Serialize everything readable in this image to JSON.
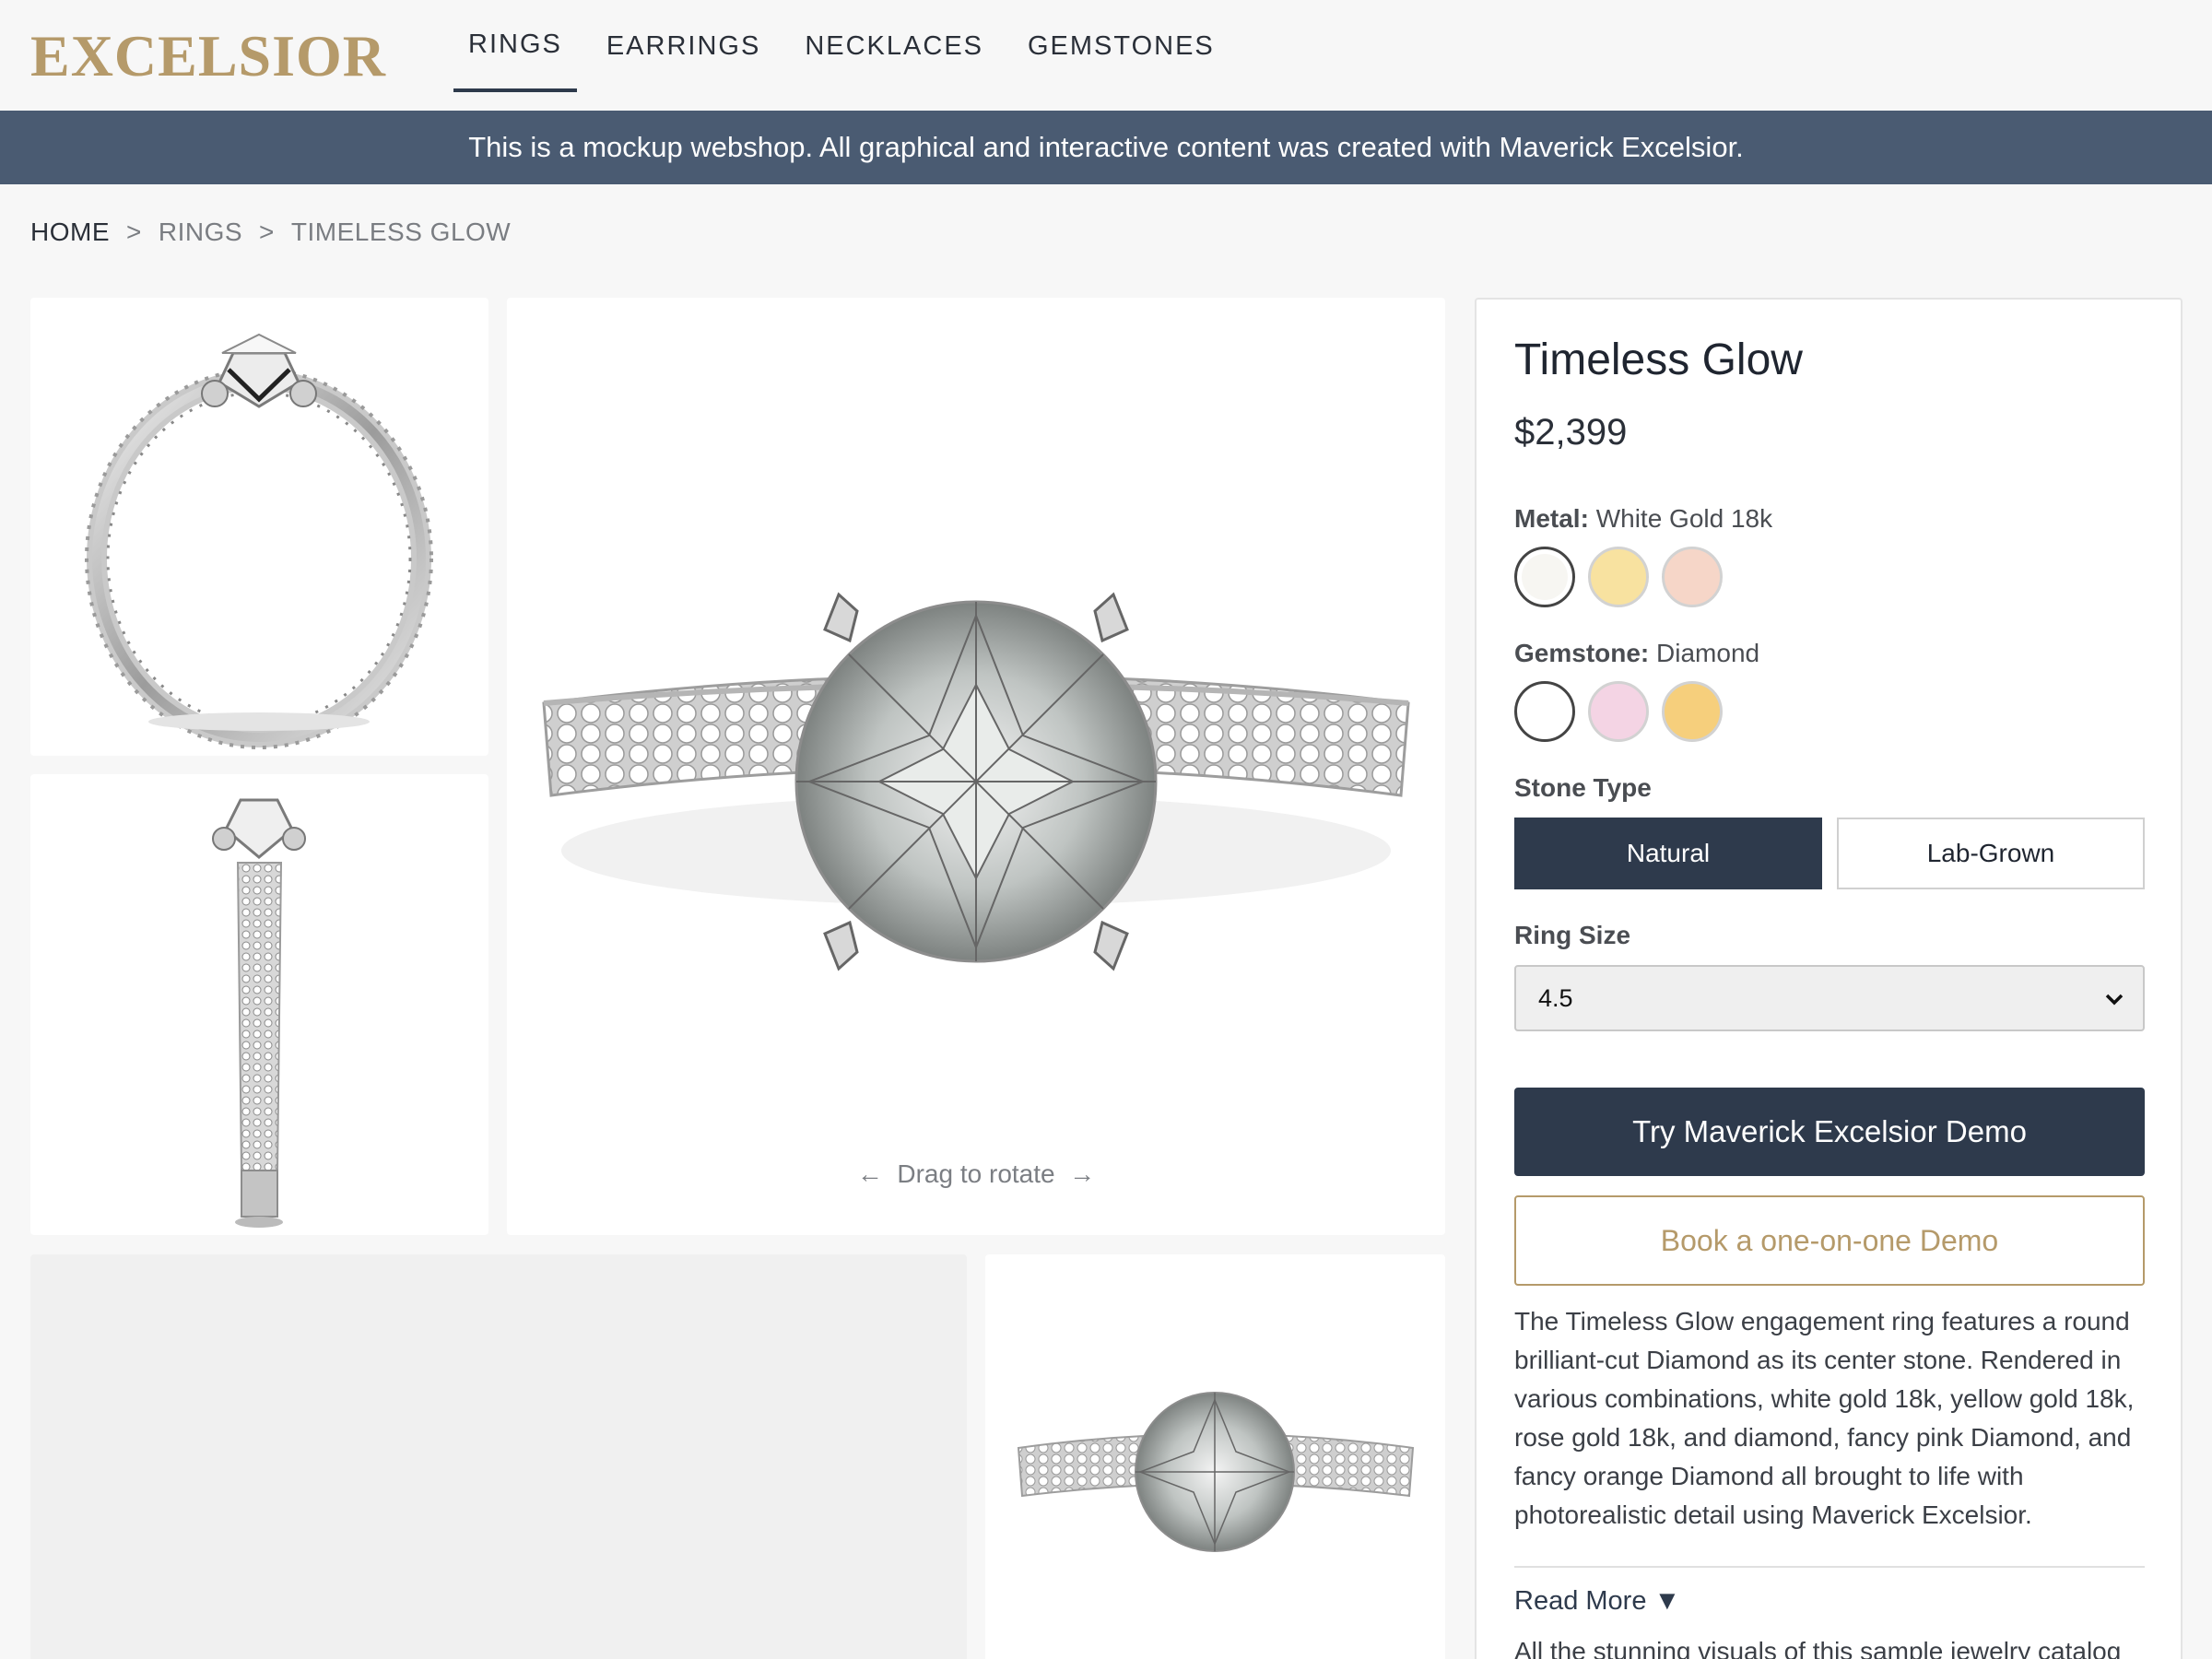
{
  "brand": {
    "logo": "EXCELSIOR",
    "accent": "#b59a6a",
    "dark": "#2e3a4c"
  },
  "nav": {
    "items": [
      "RINGS",
      "EARRINGS",
      "NECKLACES",
      "GEMSTONES"
    ],
    "active": "RINGS"
  },
  "banner": {
    "text": "This is a mockup webshop. All graphical and interactive content was created with Maverick Excelsior.",
    "color": "#4a5b72"
  },
  "breadcrumb": {
    "home": "HOME",
    "sep": ">",
    "category": "RINGS",
    "current": "TIMELESS GLOW"
  },
  "gallery": {
    "drag_hint": "Drag to rotate",
    "left_arrow": "←",
    "right_arrow": "→"
  },
  "product": {
    "title": "Timeless Glow",
    "price": "$2,399",
    "metal": {
      "label": "Metal:",
      "value": "White Gold 18k",
      "swatches": [
        "#f7f6f2",
        "#f8e2a0",
        "#f6d6c8"
      ]
    },
    "gemstone": {
      "label": "Gemstone:",
      "value": "Diamond",
      "swatches": [
        "#ffffff",
        "#f4d4e4",
        "#f6cf7c"
      ]
    },
    "stone_type": {
      "label": "Stone Type",
      "options": [
        "Natural",
        "Lab-Grown"
      ],
      "selected": "Natural"
    },
    "ring_size": {
      "label": "Ring Size",
      "value": "4.5"
    },
    "primary_cta": "Try Maverick Excelsior Demo",
    "secondary_cta": "Book a one-on-one Demo",
    "description": "The Timeless Glow engagement ring features a round brilliant-cut Diamond as its center stone. Rendered in various combinations, white gold 18k, yellow gold 18k, rose gold 18k, and diamond, fancy pink Diamond, and fancy orange Diamond all brought to life with photorealistic detail using Maverick Excelsior.",
    "read_more": "Read More ▼",
    "more_text": "All the stunning visuals of this sample jewelry catalog"
  }
}
